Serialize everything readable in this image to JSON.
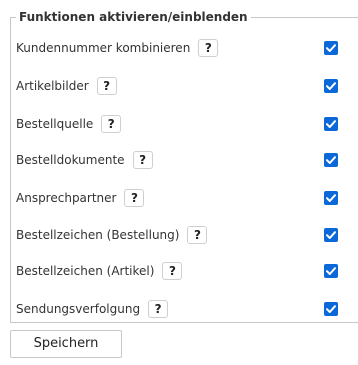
{
  "section": {
    "legend": "Funktionen aktivieren/einblenden",
    "help_label": "?",
    "options": [
      {
        "label": "Kundennummer kombinieren",
        "checked": true
      },
      {
        "label": "Artikelbilder",
        "checked": true
      },
      {
        "label": "Bestellquelle",
        "checked": true
      },
      {
        "label": "Bestelldokumente",
        "checked": true
      },
      {
        "label": "Ansprechpartner",
        "checked": true
      },
      {
        "label": "Bestellzeichen (Bestellung)",
        "checked": true
      },
      {
        "label": "Bestellzeichen (Artikel)",
        "checked": true
      },
      {
        "label": "Sendungsverfolgung",
        "checked": true
      }
    ]
  },
  "actions": {
    "save_label": "Speichern"
  },
  "colors": {
    "checkbox_fill": "#0a68d8",
    "border": "#c8c8c8",
    "text": "#333333"
  },
  "icons": {
    "help": "question-mark-icon",
    "checkbox": "checkmark-icon"
  }
}
